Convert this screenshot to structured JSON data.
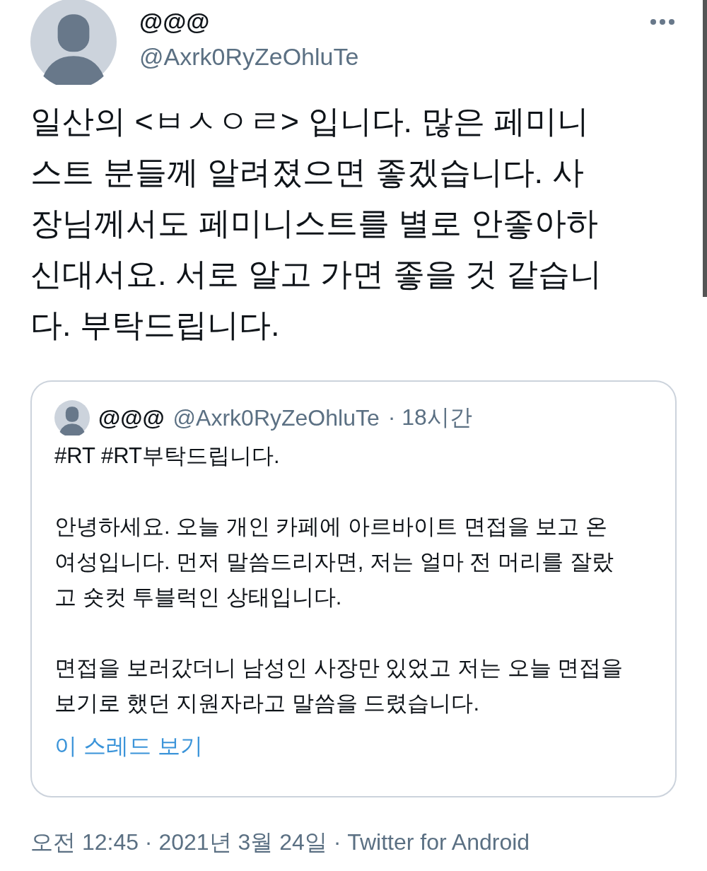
{
  "tweet": {
    "author": {
      "name": "@@@",
      "handle": "@Axrk0RyZeOhluTe"
    },
    "text": "일산의 <ㅂㅅㅇㄹ> 입니다. 많은 페미니\n스트 분들께 알려졌으면 좋겠습니다. 사\n장님께서도 페미니스트를 별로 안좋아하\n신대서요. 서로 알고 가면 좋을 것 같습니\n다. 부탁드립니다.",
    "quoted": {
      "name": "@@@",
      "handle": "@Axrk0RyZeOhluTe",
      "time": "· 18시간",
      "paragraphs": [
        "#RT #RT부탁드립니다.",
        "안녕하세요. 오늘 개인 카페에 아르바이트 면접을 보고 온\n여성입니다. 먼저 말씀드리자면, 저는 얼마 전 머리를 잘랐\n고 숏컷 투블럭인 상태입니다.",
        "면접을 보러갔더니 남성인 사장만 있었고 저는 오늘 면접을\n보기로 했던 지원자라고 말씀을 드렸습니다."
      ],
      "link": "이 스레드 보기"
    },
    "footer": "오전 12:45 · 2021년 3월 24일 · Twitter for Android"
  }
}
